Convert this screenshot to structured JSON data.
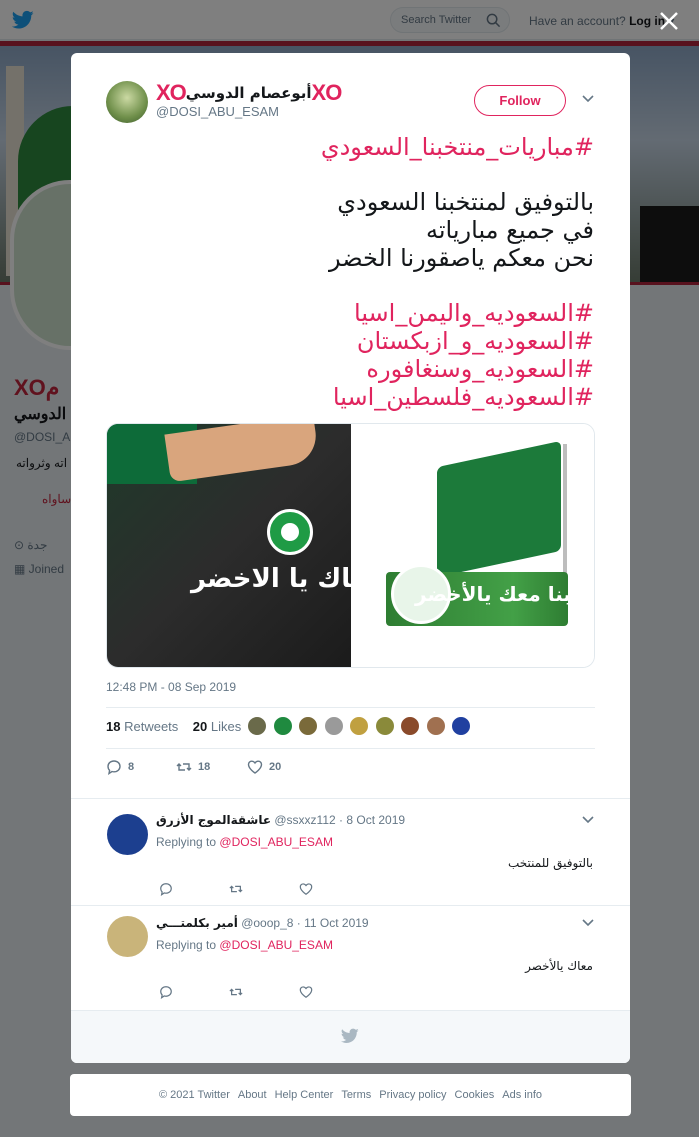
{
  "topbar": {
    "search_placeholder": "Search Twitter",
    "account_prompt": "Have an account?",
    "login_label": "Log in"
  },
  "background_profile": {
    "name_xo": "XO",
    "name_rest": "م",
    "name_line2": "الدوسي",
    "handle": "@DOSI_A",
    "bio_fragment": "اته وثرواته",
    "link_fragment": "ساواه",
    "location": "جدة",
    "joined": "Joined"
  },
  "modal": {
    "author": {
      "xo_left": "XO",
      "display_name": "أبوعصام الدوسي",
      "xo_right": "XO",
      "handle": "@DOSI_ABU_ESAM"
    },
    "follow_label": "Follow",
    "tweet": {
      "hashtag_top": "#مباريات_منتخبنا_السعودي",
      "lines": [
        "بالتوفيق لمنتخبنا السعودي",
        "في جميع مبارياته",
        "نحن معكم ياصقورنا الخضر"
      ],
      "hashtags": [
        "#السعوديه_واليمن_اسيا",
        "#السعوديه_و_ازبكستان",
        "#السعوديه_وسنغافوره",
        "#السعوديه_فلسطين_اسيا"
      ],
      "image_text_left": "معاك يا الاخضر",
      "image_text_right": "قلوبنا معك يالأخضر",
      "timestamp": "12:48 PM - 08 Sep 2019",
      "retweets_count": "18",
      "retweets_label": "Retweets",
      "likes_count": "20",
      "likes_label": "Likes",
      "reply_count": "8",
      "retweet_count": "18",
      "like_count": "20"
    },
    "likers_colors": [
      "#6a6a4a",
      "#1f8a3f",
      "#7a6a3a",
      "#9a9a9a",
      "#c0a040",
      "#8a8a3a",
      "#8a4a2a",
      "#a07050",
      "#2040a0"
    ],
    "replies": [
      {
        "display_name": "عاشقةالموج الأزرق",
        "handle": "@ssxxz112",
        "date": "· 8 Oct 2019",
        "replying_prefix": "Replying to",
        "replying_to": "@DOSI_ABU_ESAM",
        "text": "بالتوفيق للمنتخب",
        "avatar_color": "#1c3f8f"
      },
      {
        "display_name": "أمير بكلمتـــي",
        "handle": "@ooop_8",
        "date": "· 11 Oct 2019",
        "replying_prefix": "Replying to",
        "replying_to": "@DOSI_ABU_ESAM",
        "text": "معاك يالأخصر",
        "avatar_color": "#c9b47a"
      }
    ]
  },
  "footer": {
    "links": [
      "© 2021 Twitter",
      "About",
      "Help Center",
      "Terms",
      "Privacy policy",
      "Cookies",
      "Ads info"
    ]
  },
  "colors": {
    "accent": "#e0245e",
    "twitter_blue": "#1da1f2",
    "muted": "#657786"
  }
}
